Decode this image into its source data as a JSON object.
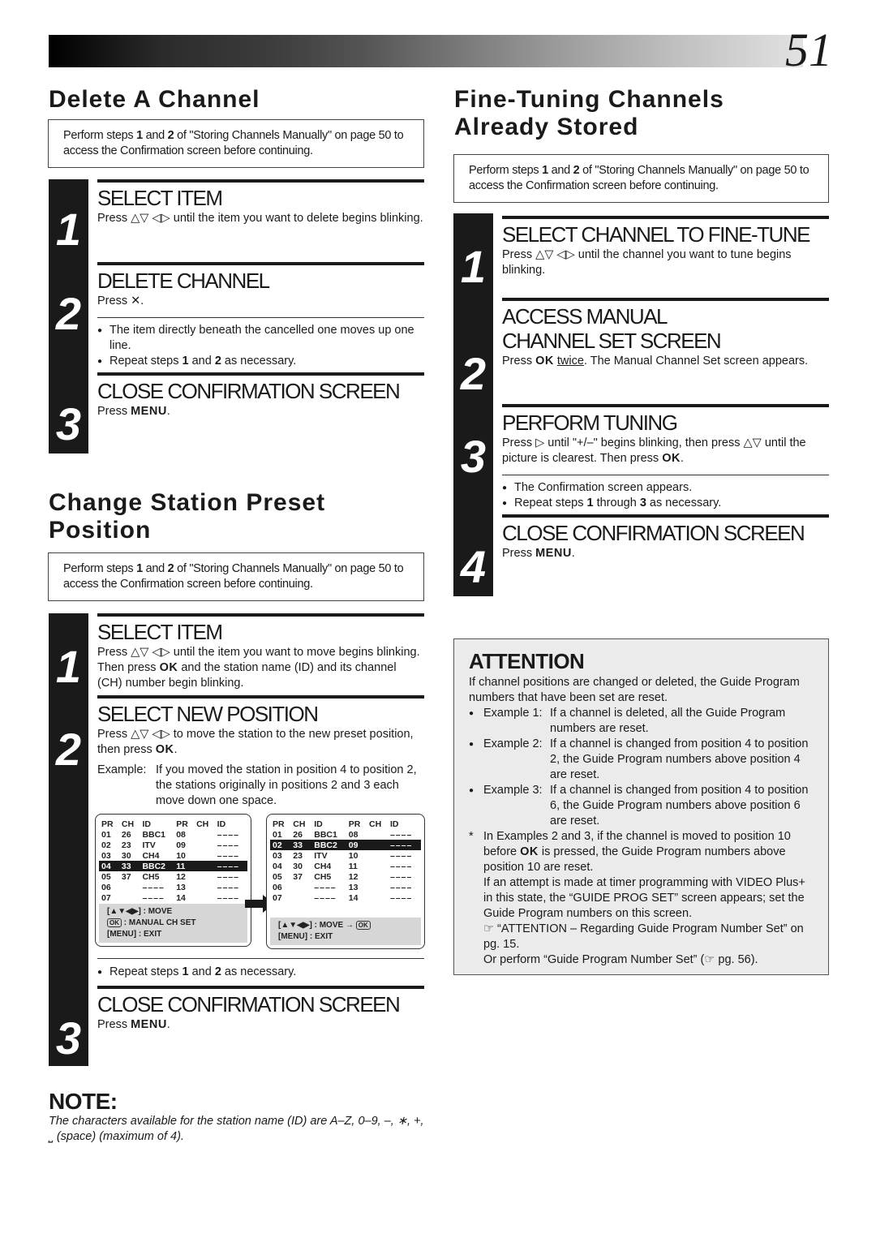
{
  "header": {
    "page_number": "51"
  },
  "delete_channel": {
    "title": "Delete A Channel",
    "intro": [
      "Perform steps ",
      "1",
      " and ",
      "2",
      " of \"Storing Channels Manually\" on page 50 to access the Confirmation screen before continuing."
    ],
    "steps": [
      {
        "number": "1",
        "title": "SELECT ITEM",
        "text": "Press △▽ ◁▷ until the item you want to delete begins blinking."
      },
      {
        "number": "2",
        "title": "DELETE CHANNEL",
        "text_prefix": "Press ",
        "text_key": "✕",
        "text_suffix": ".",
        "bullets": [
          "The item directly beneath the cancelled one moves up one line."
        ],
        "repeat": {
          "pre": "Repeat steps ",
          "a": "1",
          "mid": " and ",
          "b": "2",
          "post": " as necessary."
        }
      },
      {
        "number": "3",
        "title": "CLOSE CONFIRMATION SCREEN",
        "text_prefix": "Press ",
        "text_key": "MENU",
        "text_suffix": "."
      }
    ]
  },
  "change_position": {
    "title_line1": "Change Station Preset",
    "title_line2": "Position",
    "intro": [
      "Perform steps ",
      "1",
      " and ",
      "2",
      " of \"Storing Channels Manually\" on page 50 to access the Confirmation screen before continuing."
    ],
    "steps": [
      {
        "number": "1",
        "title": "SELECT ITEM",
        "text_pre": "Press △▽ ◁▷ until the item you want to move begins blinking. Then press ",
        "text_key": "OK",
        "text_post": " and the station name (ID) and its channel (CH) number begin blinking."
      },
      {
        "number": "2",
        "title": "SELECT NEW POSITION",
        "text_pre": "Press △▽ ◁▷ to move the station to the new preset position, then press ",
        "text_key": "OK",
        "text_post": ".",
        "example_label": "Example:",
        "example_text": "If you moved the station in position 4 to position 2, the stations originally in positions 2 and 3 each move down one space."
      },
      {
        "number": "3",
        "title": "CLOSE CONFIRMATION SCREEN",
        "text_prefix": "Press ",
        "text_key": "MENU",
        "text_suffix": ".",
        "repeat": {
          "pre": "Repeat steps ",
          "a": "1",
          "mid": " and ",
          "b": "2",
          "post": " as necessary."
        }
      }
    ],
    "osd_before": {
      "headers": [
        "PR",
        "CH",
        "ID",
        "PR",
        "CH",
        "ID"
      ],
      "rows": [
        [
          "01",
          "26",
          "BBC1",
          "08",
          "",
          "––––"
        ],
        [
          "02",
          "23",
          "ITV",
          "09",
          "",
          "––––"
        ],
        [
          "03",
          "30",
          "CH4",
          "10",
          "",
          "––––"
        ],
        [
          "04",
          "33",
          "BBC2",
          "11",
          "",
          "––––"
        ],
        [
          "05",
          "37",
          "CH5",
          "12",
          "",
          "––––"
        ],
        [
          "06",
          "",
          "––––",
          "13",
          "",
          "––––"
        ],
        [
          "07",
          "",
          "––––",
          "14",
          "",
          "––––"
        ]
      ],
      "highlight_row": 3,
      "footer": [
        "[▲▼◀▶] : MOVE",
        ": MANUAL CH SET",
        "[MENU] : EXIT"
      ],
      "ok_label": "OK"
    },
    "osd_after": {
      "headers": [
        "PR",
        "CH",
        "ID",
        "PR",
        "CH",
        "ID"
      ],
      "rows": [
        [
          "01",
          "26",
          "BBC1",
          "08",
          "",
          "––––"
        ],
        [
          "02",
          "33",
          "BBC2",
          "09",
          "",
          "––––"
        ],
        [
          "03",
          "23",
          "ITV",
          "10",
          "",
          "––––"
        ],
        [
          "04",
          "30",
          "CH4",
          "11",
          "",
          "––––"
        ],
        [
          "05",
          "37",
          "CH5",
          "12",
          "",
          "––––"
        ],
        [
          "06",
          "",
          "––––",
          "13",
          "",
          "––––"
        ],
        [
          "07",
          "",
          "––––",
          "14",
          "",
          "––––"
        ]
      ],
      "highlight_row": 1,
      "footer": [
        "[▲▼◀▶] : MOVE →",
        "[MENU] : EXIT"
      ],
      "ok_label": "OK"
    }
  },
  "fine_tuning": {
    "title_line1": "Fine-Tuning Channels",
    "title_line2": "Already Stored",
    "intro": [
      "Perform steps ",
      "1",
      " and ",
      "2",
      " of \"Storing Channels Manually\" on page 50 to access the Confirmation screen before continuing."
    ],
    "steps": [
      {
        "number": "1",
        "title": "SELECT CHANNEL TO FINE-TUNE",
        "text": "Press △▽ ◁▷ until the channel you want to tune begins blinking."
      },
      {
        "number": "2",
        "title_line1": "ACCESS MANUAL",
        "title_line2": "CHANNEL SET SCREEN",
        "text_pre": "Press ",
        "text_key": "OK",
        "text_u": "twice",
        "text_post": ". The Manual Channel Set screen appears."
      },
      {
        "number": "3",
        "title": "PERFORM TUNING",
        "text_pre": "Press ▷ until \"+/–\" begins blinking, then press △▽ until the picture is clearest. Then press ",
        "text_key": "OK",
        "text_post": ".",
        "bullets": [
          "The Confirmation screen appears."
        ],
        "repeat": {
          "pre": "Repeat steps ",
          "a": "1",
          "mid": " through ",
          "b": "3",
          "post": " as necessary."
        }
      },
      {
        "number": "4",
        "title": "CLOSE CONFIRMATION SCREEN",
        "text_prefix": "Press ",
        "text_key": "MENU",
        "text_suffix": "."
      }
    ]
  },
  "attention": {
    "title": "ATTENTION",
    "intro": "If channel positions are changed or deleted, the Guide Program numbers that have been set are reset.",
    "examples": [
      {
        "label": "Example 1:",
        "text": "If a channel is deleted, all the Guide Program numbers are reset."
      },
      {
        "label": "Example 2:",
        "text": "If a channel is changed from position 4 to position 2, the Guide Program numbers above position 4 are reset."
      },
      {
        "label": "Example 3:",
        "text": "If a channel is changed from position 4 to position 6, the Guide Program numbers above position 6 are reset."
      }
    ],
    "star_mark": "*",
    "star_pre": "In Examples 2 and 3, if the channel is moved to position 10 before ",
    "star_key": "OK",
    "star_post": " is pressed, the Guide Program numbers above position 10 are reset.",
    "para2": "If an attempt is made at timer programming with VIDEO Plus+ in this state, the “GUIDE PROG SET” screen appears; set the Guide Program numbers on this screen.",
    "ref1": "“ATTENTION – Regarding Guide Program Number Set” on pg. 15.",
    "ref2_pre": "Or perform “Guide Program Number Set” (",
    "ref2_post": " pg. 56)."
  },
  "note": {
    "title": "NOTE:",
    "text": "The characters available for the station name (ID) are A–Z, 0–9, –, ∗, +, ⎵ (space) (maximum of 4)."
  }
}
